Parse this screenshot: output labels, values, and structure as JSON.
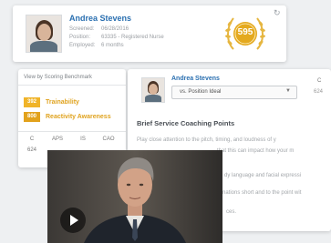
{
  "profile": {
    "name": "Andrea Stevens",
    "rows": [
      {
        "label": "Screened:",
        "value": "06/28/2016"
      },
      {
        "label": "Position:",
        "value": "63335 - Registered Nurse"
      },
      {
        "label": "Employed:",
        "value": "6 months"
      }
    ],
    "score": "595",
    "refresh_icon": "refresh-icon"
  },
  "scoring": {
    "header": "View by Scoring Benchmark",
    "traits": [
      {
        "value": "392",
        "label": "Trainability",
        "color": "#f0b429"
      },
      {
        "value": "800",
        "label": "Reactivity Awareness",
        "color": "#e2a21c"
      }
    ],
    "columns": [
      "C",
      "APS",
      "IS",
      "CAO"
    ],
    "column_values": [
      "624"
    ]
  },
  "coaching": {
    "name": "Andrea Stevens",
    "select_value": "vs. Position Ideal",
    "side_col": "C",
    "side_value": "624",
    "title": "Brief Service Coaching Points",
    "lines": [
      "Play close attention to the pitch, timing, and loudness of y",
      "that this can impact how your m",
      "dy language and facial expressi",
      "nations short and to the point wit",
      "ces."
    ]
  },
  "video": {
    "play_icon": "play-icon"
  },
  "colors": {
    "brand_blue": "#2a6fb0",
    "gold": "#e0a31f"
  }
}
